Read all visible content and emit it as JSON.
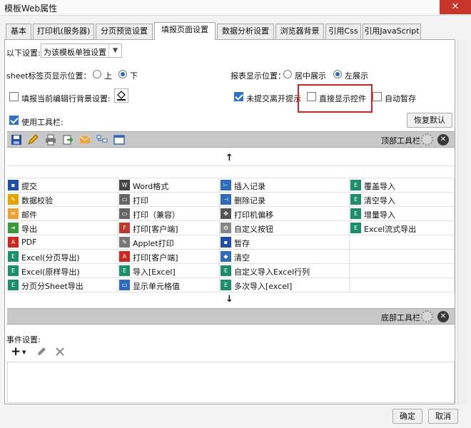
{
  "window": {
    "title": "模板Web属性",
    "close_glyph": "✕"
  },
  "tabs": [
    {
      "label": "基本",
      "active": false
    },
    {
      "label": "打印机(服务器)",
      "active": false
    },
    {
      "label": "分页预览设置",
      "active": false
    },
    {
      "label": "填报页面设置",
      "active": true
    },
    {
      "label": "数据分析设置",
      "active": false
    },
    {
      "label": "浏览器背景",
      "active": false
    },
    {
      "label": "引用Css",
      "active": false
    },
    {
      "label": "引用JavaScript",
      "active": false
    }
  ],
  "settings": {
    "apply_label": "以下设置:",
    "apply_value": "为该模板单独设置",
    "sheet_tab_label": "sheet标签页显示位置：",
    "sheet_tab_options": [
      "上",
      "下"
    ],
    "sheet_tab_selected": "下",
    "report_pos_label": "报表显示位置：",
    "report_pos_options": [
      "居中展示",
      "左展示"
    ],
    "report_pos_selected": "左展示",
    "fill_bg_label": "填报当前编辑行背景设置:",
    "fill_bg_checked": false,
    "unsubmitted_label": "未提交离开提示",
    "unsubmitted_checked": true,
    "direct_show_label": "直接显示控件",
    "direct_show_checked": false,
    "autosave_label": "自动暂存",
    "autosave_checked": false,
    "use_toolbar_label": "使用工具栏:",
    "use_toolbar_checked": true,
    "restore_default": "恢复默认"
  },
  "top_toolbar": {
    "label": "顶部工具栏",
    "icons": [
      "save-icon",
      "pencil-icon",
      "printer-icon",
      "export-icon",
      "mail-icon",
      "insert-record-icon",
      "window-icon"
    ]
  },
  "bottom_toolbar": {
    "label": "底部工具栏"
  },
  "arrows": {
    "up": "↑",
    "down": "↓"
  },
  "palette_columns": [
    [
      {
        "label": "提交",
        "icon": "save-icon",
        "color": "#1f4fa8"
      },
      {
        "label": "数据校验",
        "icon": "pencil-icon",
        "color": "#e8a500"
      },
      {
        "label": "邮件",
        "icon": "mail-icon",
        "color": "#f0a030"
      },
      {
        "label": "导出",
        "icon": "export-icon",
        "color": "#3a9a3a"
      },
      {
        "label": "PDF",
        "icon": "pdf-icon",
        "color": "#d0261d"
      },
      {
        "label": "Excel(分页导出)",
        "icon": "excel-icon",
        "color": "#1b8f6a"
      },
      {
        "label": "Excel(原样导出)",
        "icon": "excel-icon",
        "color": "#1b8f6a"
      },
      {
        "label": "分页分Sheet导出",
        "icon": "excel-icon",
        "color": "#1b8f6a"
      }
    ],
    [
      {
        "label": "Word格式",
        "icon": "word-icon",
        "color": "#444444"
      },
      {
        "label": "打印",
        "icon": "printer-icon",
        "color": "#666666"
      },
      {
        "label": "打印（兼容）",
        "icon": "printer-icon",
        "color": "#666666"
      },
      {
        "label": "打印[客户端]",
        "icon": "flash-icon",
        "color": "#c0392b"
      },
      {
        "label": "Applet打印",
        "icon": "applet-icon",
        "color": "#777777"
      },
      {
        "label": "打印[客户端]",
        "icon": "pdf-icon",
        "color": "#d0261d"
      },
      {
        "label": "导入[Excel]",
        "icon": "excel-icon",
        "color": "#1b8f6a"
      },
      {
        "label": "显示单元格值",
        "icon": "window-icon",
        "color": "#2d6bbf"
      }
    ],
    [
      {
        "label": "插入记录",
        "icon": "insert-record-icon",
        "color": "#2d6bbf"
      },
      {
        "label": "删除记录",
        "icon": "delete-record-icon",
        "color": "#2d6bbf"
      },
      {
        "label": "打印机偏移",
        "icon": "move-icon",
        "color": "#555555"
      },
      {
        "label": "自定义按钮",
        "icon": "gear-icon",
        "color": "#888888"
      },
      {
        "label": "暂存",
        "icon": "save-icon",
        "color": "#1f4fa8"
      },
      {
        "label": "清空",
        "icon": "eraser-icon",
        "color": "#2d6bbf"
      },
      {
        "label": "自定义导入Excel行列",
        "icon": "excel-icon",
        "color": "#1b8f6a"
      },
      {
        "label": "多次导入[excel]",
        "icon": "excel-icon",
        "color": "#1b8f6a"
      }
    ],
    [
      {
        "label": "覆盖导入",
        "icon": "excel-icon",
        "color": "#1b8f6a"
      },
      {
        "label": "清空导入",
        "icon": "excel-icon",
        "color": "#1b8f6a"
      },
      {
        "label": "增量导入",
        "icon": "excel-icon",
        "color": "#1b8f6a"
      },
      {
        "label": "Excel流式导出",
        "icon": "excel-icon",
        "color": "#1b8f6a"
      },
      {
        "label": "",
        "icon": "",
        "color": ""
      },
      {
        "label": "",
        "icon": "",
        "color": ""
      },
      {
        "label": "",
        "icon": "",
        "color": ""
      },
      {
        "label": "",
        "icon": "",
        "color": ""
      }
    ]
  ],
  "events": {
    "label": "事件设置:"
  },
  "footer": {
    "ok": "确定",
    "cancel": "取消"
  }
}
